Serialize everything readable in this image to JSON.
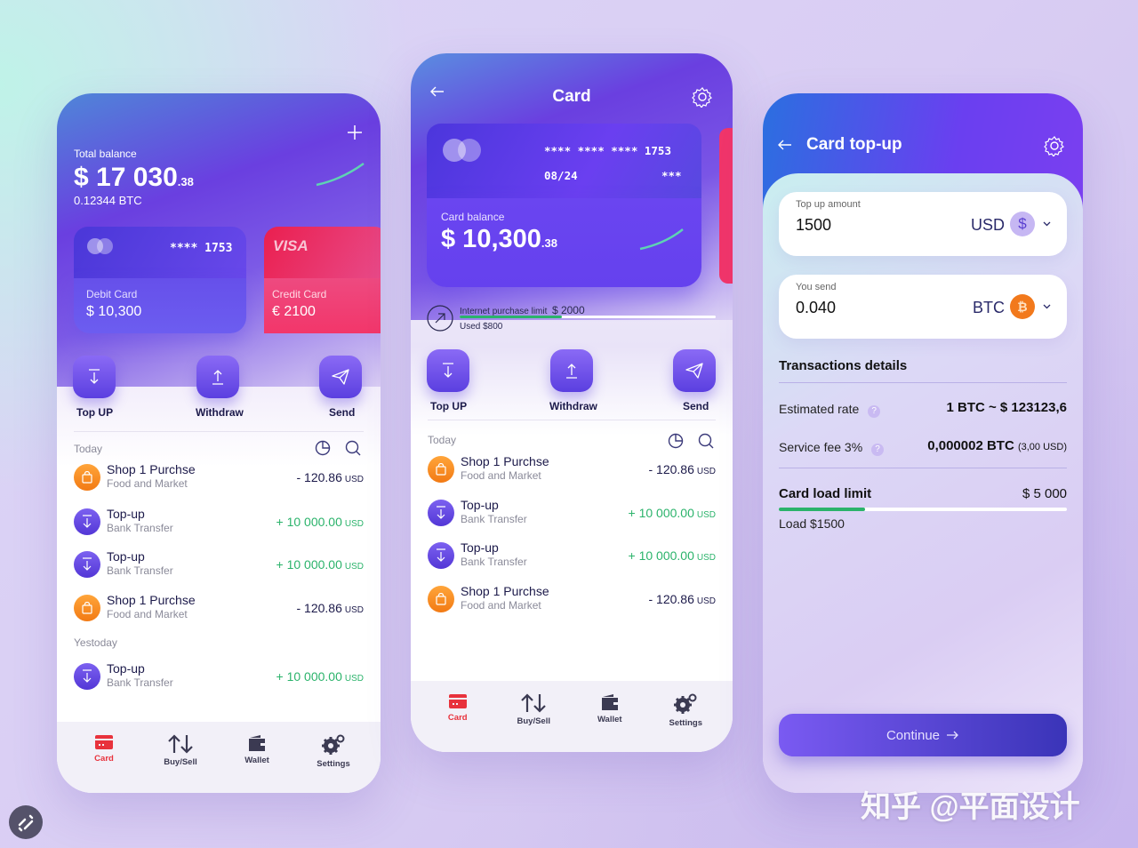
{
  "home": {
    "total_label": "Total balance",
    "total_main": "$ 17 030",
    "total_cents": ".38",
    "btc": "0.12344 BTC",
    "cards": [
      {
        "number": "**** 1753",
        "type": "Debit Card",
        "balance": "$ 10,300",
        "brand": "mastercard"
      },
      {
        "number": "",
        "type": "Credit Card",
        "balance": "€ 2100",
        "brand": "VISA"
      }
    ],
    "actions": [
      "Top UP",
      "Withdraw",
      "Send"
    ],
    "groups": [
      {
        "label": "Today",
        "items": [
          {
            "kind": "shop",
            "title": "Shop 1 Purchse",
            "sub": "Food and Market",
            "amount": "- 120.86",
            "unit": "USD"
          },
          {
            "kind": "top",
            "title": "Top-up",
            "sub": "Bank Transfer",
            "amount": "+ 10 000.00",
            "unit": "USD"
          },
          {
            "kind": "top",
            "title": "Top-up",
            "sub": "Bank Transfer",
            "amount": "+ 10 000.00",
            "unit": "USD"
          },
          {
            "kind": "shop",
            "title": "Shop 1 Purchse",
            "sub": "Food and Market",
            "amount": "- 120.86",
            "unit": "USD"
          }
        ]
      },
      {
        "label": "Yestoday",
        "items": [
          {
            "kind": "top",
            "title": "Top-up",
            "sub": "Bank Transfer",
            "amount": "+ 10 000.00",
            "unit": "USD"
          }
        ]
      }
    ]
  },
  "card": {
    "title": "Card",
    "number": "**** **** **** 1753",
    "expiry": "08/24",
    "cvv": "***",
    "balance_label": "Card balance",
    "balance_main": "$ 10,300",
    "balance_cents": ".38",
    "limit_label": "Internet  purchase limit",
    "limit_value": "$ 2000",
    "used": "Used $800",
    "limit_progress": 0.4,
    "actions": [
      "Top UP",
      "Withdraw",
      "Send"
    ],
    "group_label": "Today",
    "items": [
      {
        "kind": "shop",
        "title": "Shop 1 Purchse",
        "sub": "Food and Market",
        "amount": "- 120.86",
        "unit": "USD"
      },
      {
        "kind": "top",
        "title": "Top-up",
        "sub": "Bank Transfer",
        "amount": "+ 10 000.00",
        "unit": "USD"
      },
      {
        "kind": "top",
        "title": "Top-up",
        "sub": "Bank Transfer",
        "amount": "+ 10 000.00",
        "unit": "USD"
      },
      {
        "kind": "shop",
        "title": "Shop 1 Purchse",
        "sub": "Food and Market",
        "amount": "- 120.86",
        "unit": "USD"
      }
    ]
  },
  "nav": [
    {
      "label": "Card",
      "icon": "card-icon",
      "active": true
    },
    {
      "label": "Buy/Sell",
      "icon": "buy-sell-icon",
      "active": false
    },
    {
      "label": "Wallet",
      "icon": "wallet-icon",
      "active": false
    },
    {
      "label": "Settings",
      "icon": "settings-icon",
      "active": false
    }
  ],
  "topup": {
    "title": "Card top-up",
    "amount_label": "Top up amount",
    "amount_value": "1500",
    "amount_currency": "USD",
    "send_label": "You send",
    "send_value": "0.040",
    "send_currency": "BTC",
    "details_title": "Transactions details",
    "rate_label": "Estimated rate",
    "rate_value": "1 BTC ~ $ 123123,6",
    "fee_label": "Service fee 3%",
    "fee_value": "0,000002 BTC",
    "fee_usd": "(3,00 USD)",
    "limit_label": "Card load limit",
    "limit_value": "$ 5 000",
    "load_label": "Load  $1500",
    "load_progress": 0.3,
    "continue": "Continue"
  },
  "watermark": "知乎 @平面设计",
  "colors": {
    "accent": "#5b3fe0",
    "positive": "#2bb36b",
    "active_nav": "#e8323c",
    "shop": "#f27a14",
    "credit": "#ee2f63"
  }
}
